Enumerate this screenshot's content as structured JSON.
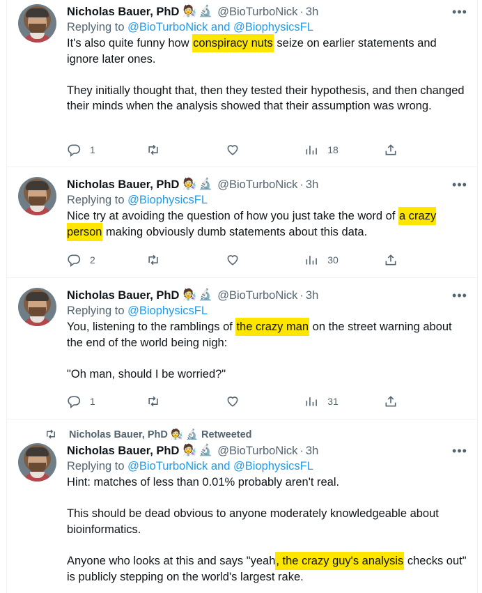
{
  "tweets": [
    {
      "author": "Nicholas Bauer, PhD",
      "badges": [
        "🧑‍🔬",
        "🔬"
      ],
      "handle": "@BioTurboNick",
      "dot": "·",
      "time": "3h",
      "more": "•••",
      "replying_prefix": "Replying to ",
      "replying_mentions": "@BioTurboNick and @BiophysicsFL",
      "paragraphs": [
        {
          "before": "It's also quite funny how ",
          "highlight": "conspiracy nuts",
          "after": " seize on earlier statements and ignore later ones."
        },
        {
          "before": "They initially thought that, then they tested their hypothesis, and then changed their minds when the analysis showed that their assumption was wrong.",
          "highlight": "",
          "after": ""
        }
      ],
      "replies": "1",
      "retweets": "",
      "likes": "",
      "views": "18"
    },
    {
      "author": "Nicholas Bauer, PhD",
      "badges": [
        "🧑‍🔬",
        "🔬"
      ],
      "handle": "@BioTurboNick",
      "dot": "·",
      "time": "3h",
      "more": "•••",
      "replying_prefix": "Replying to ",
      "replying_mentions": "@BiophysicsFL",
      "paragraphs": [
        {
          "before": "Nice try at avoiding the question of how you just take the word of ",
          "highlight": "a crazy person",
          "after": " making obviously dumb statements about this data."
        }
      ],
      "replies": "2",
      "retweets": "",
      "likes": "",
      "views": "30"
    },
    {
      "author": "Nicholas Bauer, PhD",
      "badges": [
        "🧑‍🔬",
        "🔬"
      ],
      "handle": "@BioTurboNick",
      "dot": "·",
      "time": "3h",
      "more": "•••",
      "replying_prefix": "Replying to ",
      "replying_mentions": "@BiophysicsFL",
      "paragraphs": [
        {
          "before": "You, listening to the ramblings of ",
          "highlight": "the crazy man",
          "after": " on the street warning about the end of the world being nigh:"
        },
        {
          "before": "\"Oh man, should I be worried?\"",
          "highlight": "",
          "after": ""
        }
      ],
      "replies": "1",
      "retweets": "",
      "likes": "",
      "views": "31"
    },
    {
      "retweeted_by": "Nicholas Bauer, PhD 🧑‍🔬 🔬 Retweeted",
      "author": "Nicholas Bauer, PhD",
      "badges": [
        "🧑‍🔬",
        "🔬"
      ],
      "handle": "@BioTurboNick",
      "dot": "·",
      "time": "3h",
      "more": "•••",
      "replying_prefix": "Replying to ",
      "replying_mentions": "@BioTurboNick and @BiophysicsFL",
      "paragraphs": [
        {
          "before": "Hint: matches of less than 0.01% probably aren't real.",
          "highlight": "",
          "after": ""
        },
        {
          "before": "This should be dead obvious to anyone moderately knowledgeable about bioinformatics.",
          "highlight": "",
          "after": ""
        },
        {
          "before": "Anyone who looks at this and says \"yeah",
          "highlight": ", the crazy guy's analysis",
          "after": " checks out\" is publicly stepping on the world's largest rake."
        }
      ]
    }
  ],
  "colors": {
    "highlight": "#ffe600",
    "link": "#1d9bf0",
    "muted": "#536471"
  },
  "icons": [
    "more-icon",
    "reply-icon",
    "retweet-icon",
    "like-icon",
    "views-icon",
    "share-icon"
  ]
}
